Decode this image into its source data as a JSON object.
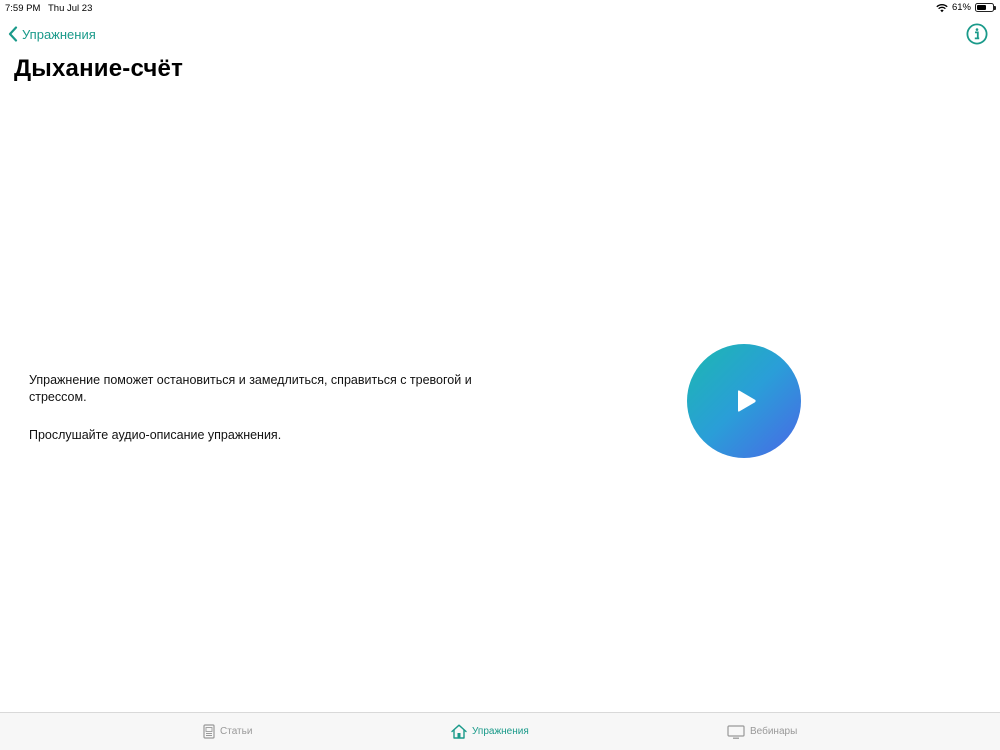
{
  "status_bar": {
    "time": "7:59 PM",
    "date": "Thu Jul 23",
    "battery": "61%",
    "battery_level": 0.61
  },
  "nav": {
    "back_label": "Упражнения",
    "back_icon": "chevron-left-icon",
    "info_icon": "info-circle-icon"
  },
  "page": {
    "title": "Дыхание-счёт"
  },
  "description": {
    "paragraph_1": "Упражнение поможет остановиться и замедлиться, справиться с тревогой и стрессом.",
    "paragraph_2": "Прослушайте аудио-описание упражнения."
  },
  "player": {
    "play_icon": "play-icon"
  },
  "tabs": [
    {
      "label": "Статьи",
      "icon": "article-icon",
      "active": false
    },
    {
      "label": "Упражнения",
      "icon": "home-icon",
      "active": true
    },
    {
      "label": "Вебинары",
      "icon": "monitor-icon",
      "active": false
    }
  ],
  "colors": {
    "accent": "#1a9a8a",
    "inactive_tab": "#999999",
    "gradient_start": "#1cb8b0",
    "gradient_end": "#4a67e6"
  }
}
